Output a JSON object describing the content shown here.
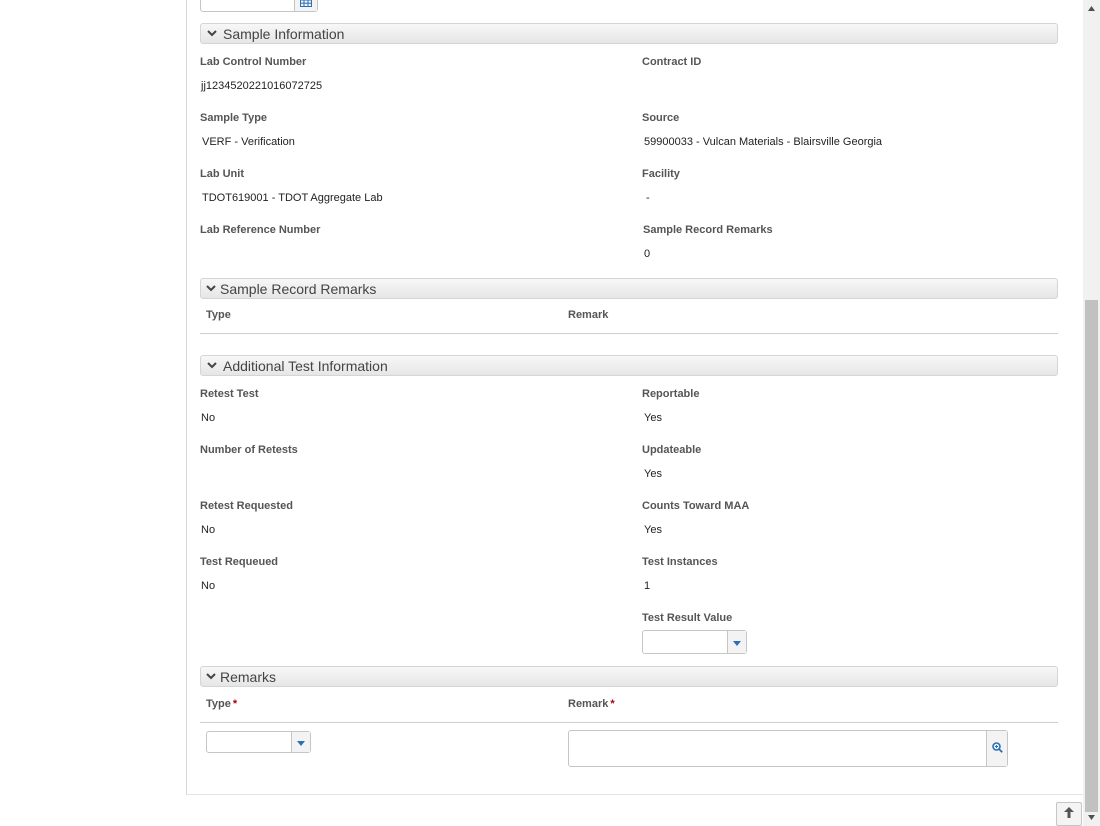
{
  "sample_info": {
    "title": "Sample Information",
    "fields": {
      "lab_control_number": {
        "label": "Lab Control Number",
        "value": "jj1234520221016072725"
      },
      "contract_id": {
        "label": "Contract ID",
        "value": ""
      },
      "sample_type": {
        "label": "Sample Type",
        "value": "VERF - Verification"
      },
      "source": {
        "label": "Source",
        "value": "59900033 - Vulcan Materials - Blairsville Georgia"
      },
      "lab_unit": {
        "label": "Lab Unit",
        "value": "TDOT619001 - TDOT Aggregate Lab"
      },
      "facility": {
        "label": "Facility",
        "value": "-"
      },
      "lab_reference_number": {
        "label": "Lab Reference Number",
        "value": ""
      },
      "sample_record_remarks": {
        "label": "Sample Record Remarks",
        "value": "0"
      }
    }
  },
  "sample_record_remarks": {
    "title": "Sample Record Remarks",
    "columns": [
      "Type",
      "Remark"
    ]
  },
  "additional_info": {
    "title": "Additional Test Information",
    "fields": {
      "retest_test": {
        "label": "Retest Test",
        "value": "No"
      },
      "reportable": {
        "label": "Reportable",
        "value": "Yes"
      },
      "number_of_retests": {
        "label": "Number of Retests",
        "value": ""
      },
      "updateable": {
        "label": "Updateable",
        "value": "Yes"
      },
      "retest_requested": {
        "label": "Retest Requested",
        "value": "No"
      },
      "counts_toward_maa": {
        "label": "Counts Toward MAA",
        "value": "Yes"
      },
      "test_requeued": {
        "label": "Test Requeued",
        "value": "No"
      },
      "test_instances": {
        "label": "Test Instances",
        "value": "1"
      },
      "test_result_value": {
        "label": "Test Result Value",
        "value": ""
      }
    }
  },
  "remarks": {
    "title": "Remarks",
    "columns": [
      "Type",
      "Remark"
    ],
    "required_marker": "*",
    "type_value": "",
    "remark_value": ""
  },
  "icons": {
    "section_toggle": "chevron-down-icon",
    "calendar": "calendar-icon",
    "dropdown": "caret-down-icon",
    "zoom": "zoom-icon",
    "back_to_top": "arrow-up-icon"
  },
  "colors": {
    "required": "#b10000",
    "icon_blue": "#2a6fb8"
  }
}
